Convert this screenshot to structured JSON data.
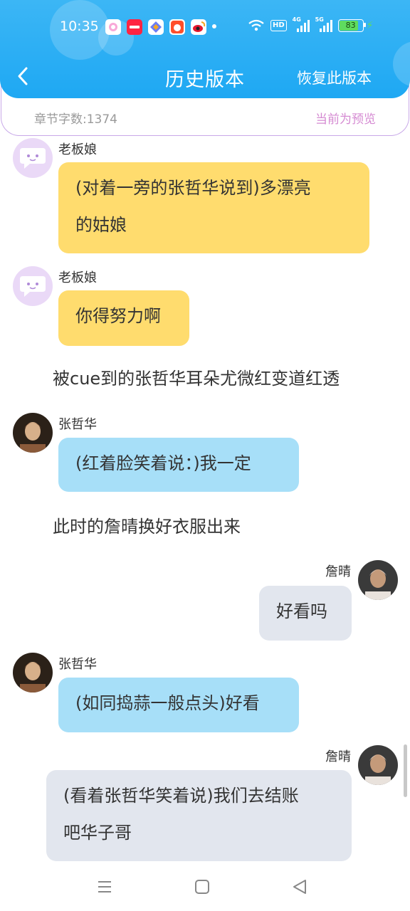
{
  "status_bar": {
    "time": "10:35",
    "hd_label": "HD",
    "signal_1_label": "4G",
    "signal_2_label": "5G",
    "battery_level": "83",
    "app_icons": [
      "kuaishou-icon",
      "xiaohongshu-icon",
      "tool-app-icon",
      "taobao-icon",
      "weibo-icon"
    ]
  },
  "header": {
    "title": "历史版本",
    "restore_label": "恢复此版本"
  },
  "info": {
    "char_count": "章节字数:1374",
    "preview_label": "当前为预览"
  },
  "chat": [
    {
      "type": "message",
      "side": "left",
      "speaker": "老板娘",
      "avatar": "npc-chat-icon",
      "color": "yellow",
      "lines": [
        "(对着一旁的张哲华说到)多漂亮",
        "的姑娘"
      ]
    },
    {
      "type": "message",
      "side": "left",
      "speaker": "老板娘",
      "avatar": "npc-chat-icon",
      "color": "yellow",
      "lines": [
        "你得努力啊"
      ]
    },
    {
      "type": "narration",
      "text": "被cue到的张哲华耳朵尤微红变道红透"
    },
    {
      "type": "message",
      "side": "left",
      "speaker": "张哲华",
      "avatar": "photo",
      "color": "blue",
      "lines": [
        "(红着脸笑着说：)我一定"
      ]
    },
    {
      "type": "narration",
      "text": "此时的詹晴换好衣服出来"
    },
    {
      "type": "message",
      "side": "right",
      "speaker": "詹晴",
      "avatar": "photo",
      "color": "gray",
      "lines": [
        "好看吗"
      ]
    },
    {
      "type": "message",
      "side": "left",
      "speaker": "张哲华",
      "avatar": "photo",
      "color": "blue",
      "lines": [
        "(如同捣蒜一般点头)好看"
      ]
    },
    {
      "type": "message",
      "side": "right",
      "speaker": "詹晴",
      "avatar": "photo",
      "color": "gray",
      "lines": [
        "(看着张哲华笑着说)我们去结账",
        "吧华子哥"
      ]
    }
  ],
  "colors": {
    "header_blue": "#1ea8f3",
    "bubble_yellow": "#ffdc6e",
    "bubble_blue": "#a7dff8",
    "bubble_gray": "#e2e6ee",
    "preview_pink": "#d58ad2"
  },
  "nav": [
    "menu-icon",
    "home-icon",
    "back-icon"
  ]
}
